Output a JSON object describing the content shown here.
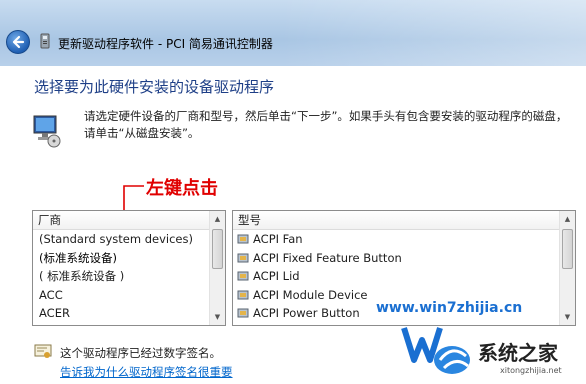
{
  "window": {
    "title": "更新驱动程序软件 - PCI 简易通讯控制器"
  },
  "page": {
    "heading": "选择要为此硬件安装的设备驱动程序",
    "instructions": "请选定硬件设备的厂商和型号，然后单击“下一步”。如果手头有包含要安装的驱动程序的磁盘，请单击“从磁盘安装”。"
  },
  "annotation": {
    "text": "左键点击",
    "color": "#e00000"
  },
  "manufacturer_list": {
    "header": "厂商",
    "items": [
      "(Standard system devices)",
      "(标准系统设备)",
      "( 标准系统设备 )",
      "ACC",
      "ACER"
    ],
    "selected_index": 1
  },
  "model_list": {
    "header": "型号",
    "items": [
      "ACPI Fan",
      "ACPI Fixed Feature Button",
      "ACPI Lid",
      "ACPI Module Device",
      "ACPI Power Button"
    ]
  },
  "footer": {
    "signed_text": "这个驱动程序已经过数字签名。",
    "why_link": "告诉我为什么驱动程序签名很重要"
  },
  "watermark": {
    "url": "www.win7zhijia.cn",
    "logo_text": "系统之家",
    "sub": "xitongzhijia.net"
  },
  "icons": {
    "back": "back-arrow-icon",
    "device": "device-icon",
    "monitor": "monitor-disk-icon",
    "chip": "driver-chip-icon",
    "certificate": "certificate-icon"
  },
  "colors": {
    "heading": "#1e3f87",
    "link": "#0066cc",
    "annotation": "#e00000"
  }
}
